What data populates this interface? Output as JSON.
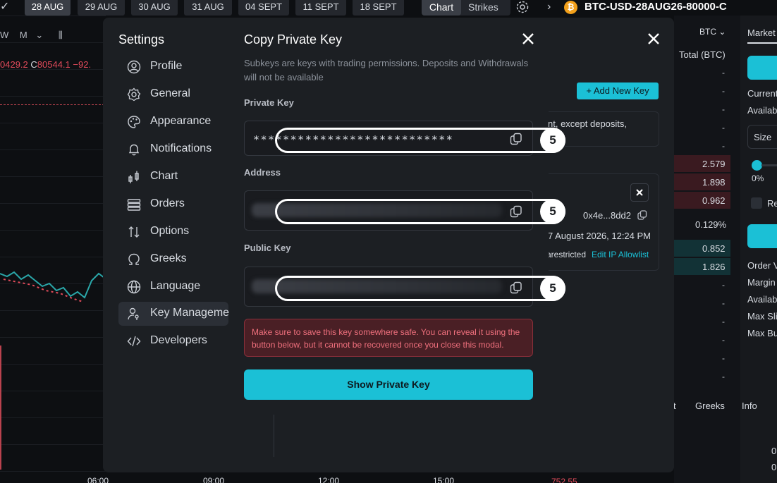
{
  "topbar": {
    "dates": [
      "28 AUG",
      "29 AUG",
      "30 AUG",
      "31 AUG",
      "04 SEPT",
      "11 SEPT",
      "18 SEPT"
    ],
    "active_date": "28 AUG",
    "view_chart": "Chart",
    "view_strikes": "Strikes",
    "coin_glyph": "₿",
    "instrument": "BTC-USD-28AUG26-80000-C"
  },
  "chart": {
    "timeframe_w": "W",
    "timeframe_m": "M",
    "ohlc_left": "0429.2",
    "ohlc_c_label": "C",
    "ohlc_c_value": "80544.1",
    "ohlc_change": "−92.",
    "time_labels": [
      "06:00",
      "09:00",
      "12:00",
      "15:00"
    ],
    "bottom_value": "752.55"
  },
  "background_panel": {
    "currency": "BTC",
    "total_header": "Total (BTC)",
    "dash": "-",
    "red_values": [
      "2.579",
      "1.898",
      "0.962"
    ],
    "percent": "0.129%",
    "green_values": [
      "0.852",
      "1.826"
    ],
    "tabs": [
      "t",
      "Greeks",
      "Info"
    ],
    "card_text": "nt, except deposits,",
    "key_address_short": "0x4e...8dd2",
    "created": "7 August 2026, 12:24 PM",
    "restricted": "arestricted",
    "edit_ip": "Edit IP Allowlist",
    "add_key": "+ Add New Key",
    "order_panel": {
      "tab": "Market",
      "current": "Current",
      "available": "Availab",
      "size": "Size",
      "slider_pct": "0%",
      "re": "Re",
      "order_value": "Order V",
      "margin": "Margin",
      "available2": "Availab",
      "max_slip": "Max Sli",
      "max_buy": "Max Bu",
      "zero1": "0",
      "zero2": "0"
    }
  },
  "settings": {
    "title": "Settings",
    "nav": [
      {
        "label": "Profile",
        "icon": "profile-icon"
      },
      {
        "label": "General",
        "icon": "gear-icon"
      },
      {
        "label": "Appearance",
        "icon": "palette-icon"
      },
      {
        "label": "Notifications",
        "icon": "bell-icon"
      },
      {
        "label": "Chart",
        "icon": "candlestick-icon"
      },
      {
        "label": "Orders",
        "icon": "orders-icon"
      },
      {
        "label": "Options",
        "icon": "arrows-icon"
      },
      {
        "label": "Greeks",
        "icon": "omega-icon"
      },
      {
        "label": "Language",
        "icon": "globe-icon"
      },
      {
        "label": "Key Managemen",
        "icon": "user-key-icon"
      },
      {
        "label": "Developers",
        "icon": "code-icon"
      }
    ],
    "active_nav": "Key Managemen"
  },
  "dialog": {
    "title": "Copy Private Key",
    "description": "Subkeys are keys with trading permissions. Deposits and Withdrawals will not be available",
    "private_key_label": "Private Key",
    "private_key_value": "***************************",
    "address_label": "Address",
    "public_key_label": "Public Key",
    "warning": "Make sure to save this key somewhere safe. You can reveal it using the button below, but it cannot be recovered once you close this modal.",
    "show_button": "Show Private Key",
    "highlight_number": "5"
  },
  "colors": {
    "accent": "#1bc0d6",
    "danger": "#f0707d",
    "modal_bg": "#1c1f23"
  }
}
